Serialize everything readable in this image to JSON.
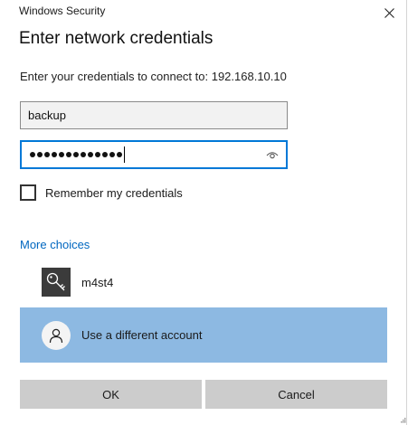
{
  "window": {
    "title": "Windows Security",
    "close_icon": "close-icon"
  },
  "dialog": {
    "heading": "Enter network credentials",
    "subtitle": "Enter your credentials to connect to: 192.168.10.10"
  },
  "form": {
    "username_value": "backup",
    "password_masked_length": 13,
    "password_reveal_icon": "eye-icon",
    "remember_label": "Remember my credentials",
    "remember_checked": false
  },
  "choices": {
    "more_label": "More choices",
    "accounts": [
      {
        "name": "m4st4",
        "icon": "key-icon"
      }
    ],
    "different_account_label": "Use a different account",
    "different_account_icon": "user-icon"
  },
  "buttons": {
    "ok_label": "OK",
    "cancel_label": "Cancel"
  },
  "colors": {
    "accent": "#0078d7",
    "link": "#0067c0",
    "selected_row": "#8db9e2",
    "button_bg": "#cccccc"
  }
}
